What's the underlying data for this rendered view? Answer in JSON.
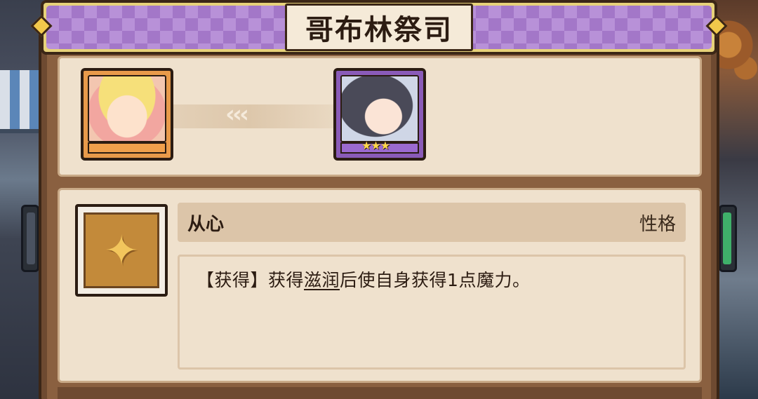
{
  "title": "哥布林祭司",
  "evolution": {
    "from_portrait": "portrait-base",
    "to_portrait": "portrait-evolved",
    "arrows": "‹‹‹",
    "to_stars": "★★★"
  },
  "trait": {
    "name": "从心",
    "type": "性格",
    "icon": "hero-silhouette-icon",
    "desc_prefix": "【获得】获得",
    "desc_keyword": "滋润",
    "desc_suffix": "后使自身获得1点魔力。"
  },
  "colors": {
    "banner_purple": "#a377c8",
    "panel_brown": "#6e4a31",
    "parchment": "#efe1cd",
    "icon_gold": "#c38a3a"
  }
}
